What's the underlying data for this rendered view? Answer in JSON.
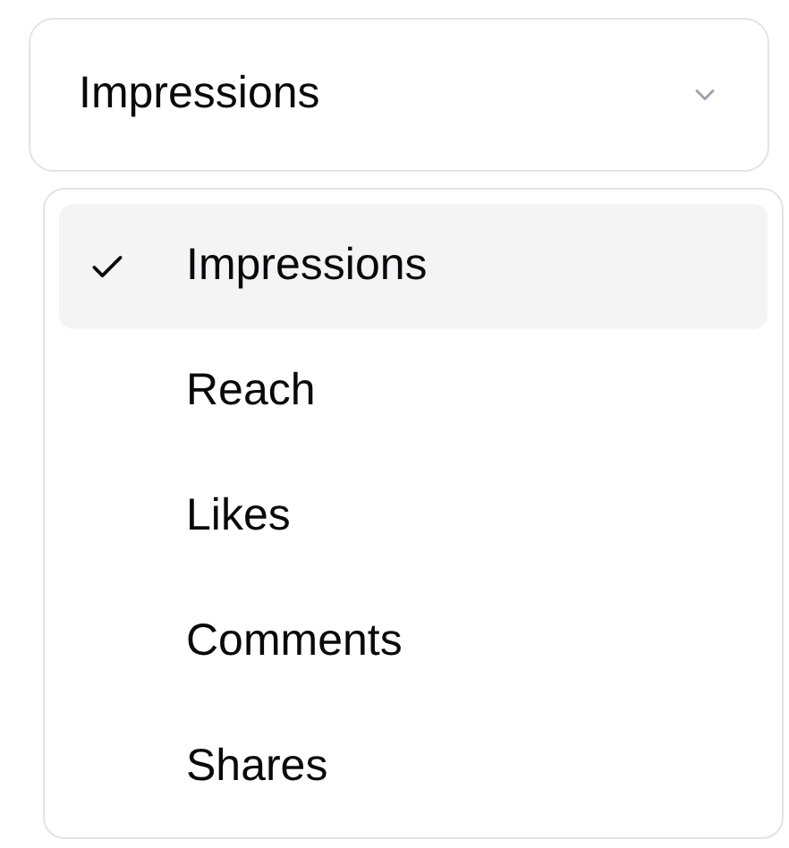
{
  "select": {
    "value": "Impressions",
    "expanded": true
  },
  "options": [
    {
      "label": "Impressions",
      "selected": true
    },
    {
      "label": "Reach",
      "selected": false
    },
    {
      "label": "Likes",
      "selected": false
    },
    {
      "label": "Comments",
      "selected": false
    },
    {
      "label": "Shares",
      "selected": false
    }
  ]
}
